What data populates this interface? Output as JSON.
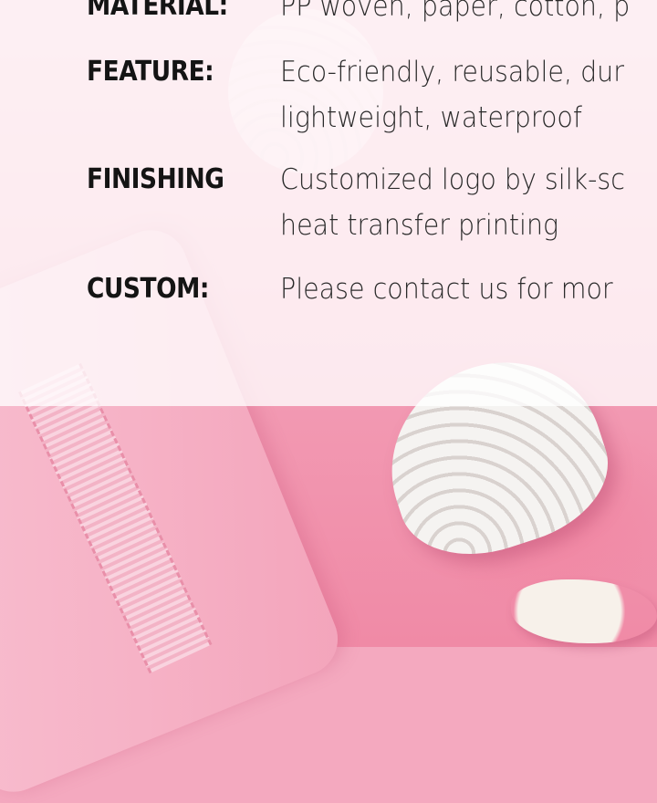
{
  "specs": [
    {
      "label": "MATERIAL:",
      "value": "PP woven, paper, cotton, p"
    },
    {
      "label": "FEATURE:",
      "value": "Eco-friendly, reusable, dur",
      "value2": "lightweight, waterproof"
    },
    {
      "label": "FINISHING",
      "value": "Customized logo by silk-sc",
      "value2": "heat transfer printing"
    },
    {
      "label": "CUSTOM:",
      "value": "Please contact us for mor"
    }
  ],
  "colors": {
    "panel": "#ffffff",
    "background": "#f29ab3",
    "text": "#141414"
  }
}
